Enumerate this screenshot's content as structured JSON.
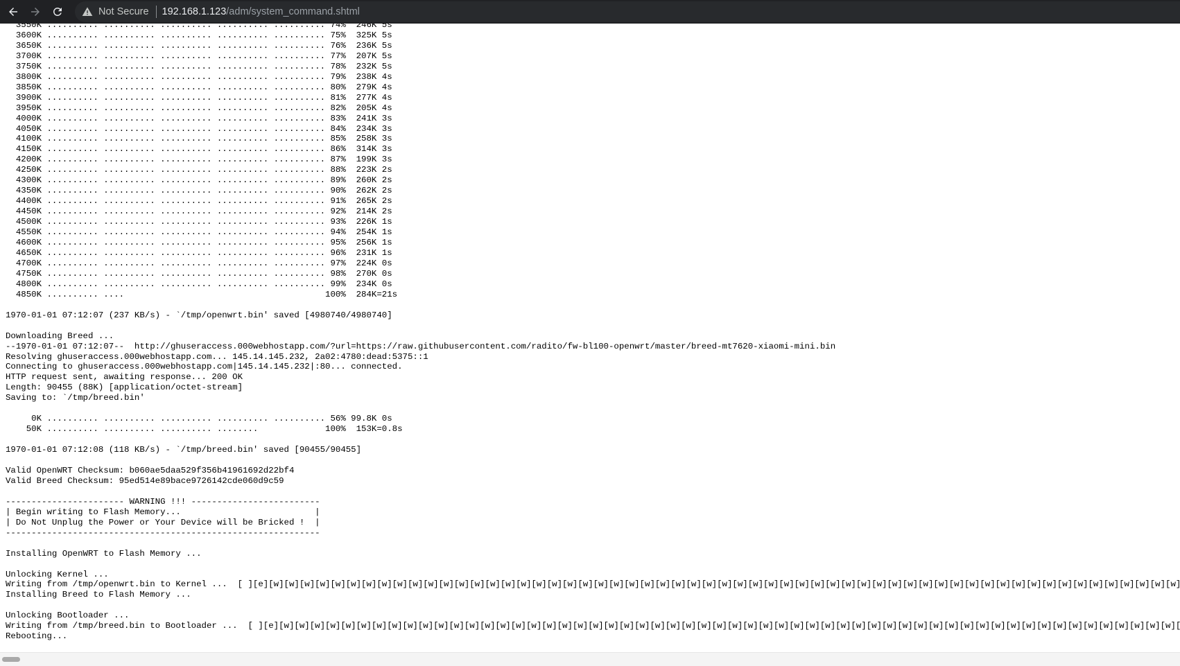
{
  "browser": {
    "security_label": "Not Secure",
    "url_host": "192.168.1.123",
    "url_path": "/adm/system_command.shtml",
    "icons": {
      "back": "back-arrow-icon",
      "forward": "forward-arrow-icon",
      "reload": "reload-icon",
      "warning": "warning-triangle-icon"
    }
  },
  "console": {
    "lines": [
      "  3550K .......... .......... .......... .......... .......... 74%  246K 5s",
      "  3600K .......... .......... .......... .......... .......... 75%  325K 5s",
      "  3650K .......... .......... .......... .......... .......... 76%  236K 5s",
      "  3700K .......... .......... .......... .......... .......... 77%  207K 5s",
      "  3750K .......... .......... .......... .......... .......... 78%  232K 5s",
      "  3800K .......... .......... .......... .......... .......... 79%  238K 4s",
      "  3850K .......... .......... .......... .......... .......... 80%  279K 4s",
      "  3900K .......... .......... .......... .......... .......... 81%  277K 4s",
      "  3950K .......... .......... .......... .......... .......... 82%  205K 4s",
      "  4000K .......... .......... .......... .......... .......... 83%  241K 3s",
      "  4050K .......... .......... .......... .......... .......... 84%  234K 3s",
      "  4100K .......... .......... .......... .......... .......... 85%  258K 3s",
      "  4150K .......... .......... .......... .......... .......... 86%  314K 3s",
      "  4200K .......... .......... .......... .......... .......... 87%  199K 3s",
      "  4250K .......... .......... .......... .......... .......... 88%  223K 2s",
      "  4300K .......... .......... .......... .......... .......... 89%  260K 2s",
      "  4350K .......... .......... .......... .......... .......... 90%  262K 2s",
      "  4400K .......... .......... .......... .......... .......... 91%  265K 2s",
      "  4450K .......... .......... .......... .......... .......... 92%  214K 2s",
      "  4500K .......... .......... .......... .......... .......... 93%  226K 1s",
      "  4550K .......... .......... .......... .......... .......... 94%  254K 1s",
      "  4600K .......... .......... .......... .......... .......... 95%  256K 1s",
      "  4650K .......... .......... .......... .......... .......... 96%  231K 1s",
      "  4700K .......... .......... .......... .......... .......... 97%  224K 0s",
      "  4750K .......... .......... .......... .......... .......... 98%  270K 0s",
      "  4800K .......... .......... .......... .......... .......... 99%  234K 0s",
      "  4850K .......... ....                                       100%  284K=21s",
      "",
      "1970-01-01 07:12:07 (237 KB/s) - `/tmp/openwrt.bin' saved [4980740/4980740]",
      "",
      "Downloading Breed ...",
      "--1970-01-01 07:12:07--  http://ghuseraccess.000webhostapp.com/?url=https://raw.githubusercontent.com/radito/fw-bl100-openwrt/master/breed-mt7620-xiaomi-mini.bin",
      "Resolving ghuseraccess.000webhostapp.com... 145.14.145.232, 2a02:4780:dead:5375::1",
      "Connecting to ghuseraccess.000webhostapp.com|145.14.145.232|:80... connected.",
      "HTTP request sent, awaiting response... 200 OK",
      "Length: 90455 (88K) [application/octet-stream]",
      "Saving to: `/tmp/breed.bin'",
      "",
      "     0K .......... .......... .......... .......... .......... 56% 99.8K 0s",
      "    50K .......... .......... .......... ........             100%  153K=0.8s",
      "",
      "1970-01-01 07:12:08 (118 KB/s) - `/tmp/breed.bin' saved [90455/90455]",
      "",
      "Valid OpenWRT Checksum: b060ae5daa529f356b41961692d22bf4",
      "Valid Breed Checksum: 95ed514e89bace9726142cde060d9c59",
      "",
      "----------------------- WARNING !!! -------------------------",
      "| Begin writing to Flash Memory...                          |",
      "| Do Not Unplug the Power or Your Device will be Bricked !  |",
      "-------------------------------------------------------------",
      "",
      "Installing OpenWRT to Flash Memory ...",
      "",
      "Unlocking Kernel ...",
      "Writing from /tmp/openwrt.bin to Kernel ...  [ ][e][w][w][w][w][w][w][w][w][w][w][w][w][w][w][w][w][w][w][w][w][w][w][w][w][w][w][w][w][w][w][w][w][w][w][w][w][w][w][w][w][w][w][w][w][w][w][w][w][w][w][w][w][w][w][w][w][w][w][w][w][w]",
      "Installing Breed to Flash Memory ...",
      "",
      "Unlocking Bootloader ...",
      "Writing from /tmp/breed.bin to Bootloader ...  [ ][e][w][w][w][w][w][w][w][w][w][w][w][w][w][w][w][w][w][w][w][w][w][w][w][w][w][w][w][w][w][w][w][w][w][w][w][w][w][w][w][w][w][w][w][w][w][w][w][w][w][w][w][w][w][w][w][w][w][w][w][w][w]",
      "Rebooting..."
    ]
  }
}
